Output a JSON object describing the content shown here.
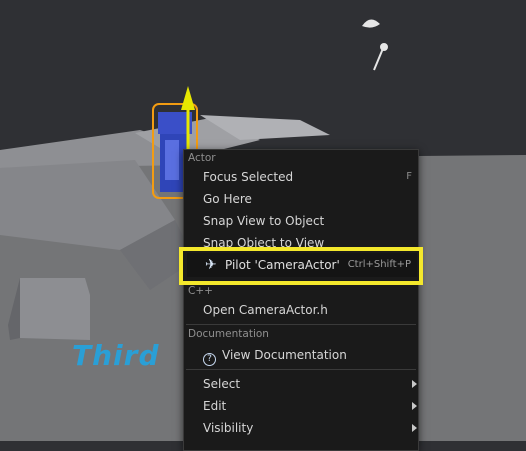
{
  "viewport_text": "Third",
  "menu": {
    "actor_header": "Actor",
    "focus_selected": "Focus Selected",
    "focus_shortcut": "F",
    "go_here": "Go Here",
    "snap_view": "Snap View to Object",
    "snap_object": "Snap Object to View",
    "pilot": "Pilot 'CameraActor'",
    "pilot_shortcut": "Ctrl+Shift+P",
    "cpp_header": "C++",
    "open_header_file": "Open CameraActor.h",
    "doc_header": "Documentation",
    "view_doc": "View Documentation",
    "select": "Select",
    "edit": "Edit",
    "visibility": "Visibility"
  },
  "icons": [
    "camera-actor-icon",
    "light-icon",
    "airplane-icon",
    "help-circle-icon",
    "submenu-arrow-icon"
  ],
  "colors": {
    "highlight": "#f4e82c",
    "gizmo_up": "#e8e800",
    "selection_outline": "#f39c12"
  }
}
